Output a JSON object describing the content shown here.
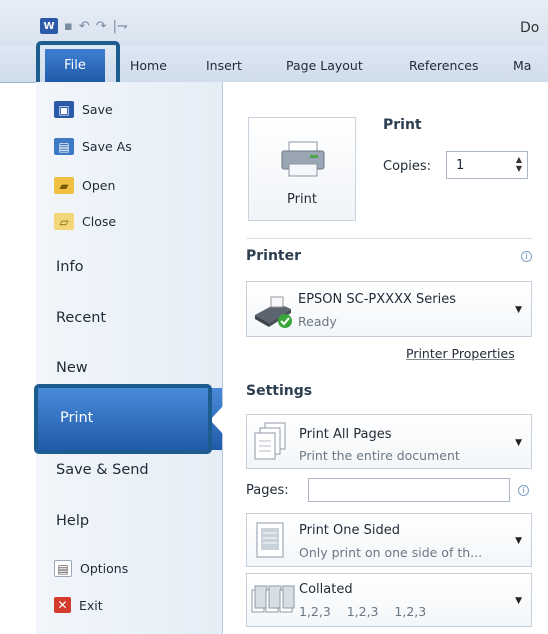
{
  "title_bar": {
    "doc_title": "Do"
  },
  "tabs": {
    "file": "File",
    "items": [
      "Home",
      "Insert",
      "Page Layout",
      "References",
      "Ma"
    ]
  },
  "backstage": {
    "commands": [
      "Save",
      "Save As",
      "Open",
      "Close"
    ],
    "sections": [
      "Info",
      "Recent",
      "New",
      "Print",
      "Save & Send",
      "Help"
    ],
    "bottom_commands": [
      "Options",
      "Exit"
    ],
    "selected": "Print"
  },
  "print_panel": {
    "heading": "Print",
    "button_label": "Print",
    "copies_label": "Copies:",
    "copies_value": "1",
    "printer_header": "Printer",
    "printer_name": "EPSON SC-PXXXX Series",
    "printer_status": "Ready",
    "printer_properties": "Printer Properties",
    "settings_header": "Settings",
    "setting1_title": "Print All Pages",
    "setting1_sub": "Print the entire document",
    "pages_label": "Pages:",
    "setting2_title": "Print One Sided",
    "setting2_sub": "Only print on one side of th...",
    "setting3_title": "Collated",
    "setting3_sub": "1,2,3    1,2,3    1,2,3"
  },
  "colors": {
    "accent": "#1f5ba9",
    "highlight_border": "#1c5c8f"
  }
}
